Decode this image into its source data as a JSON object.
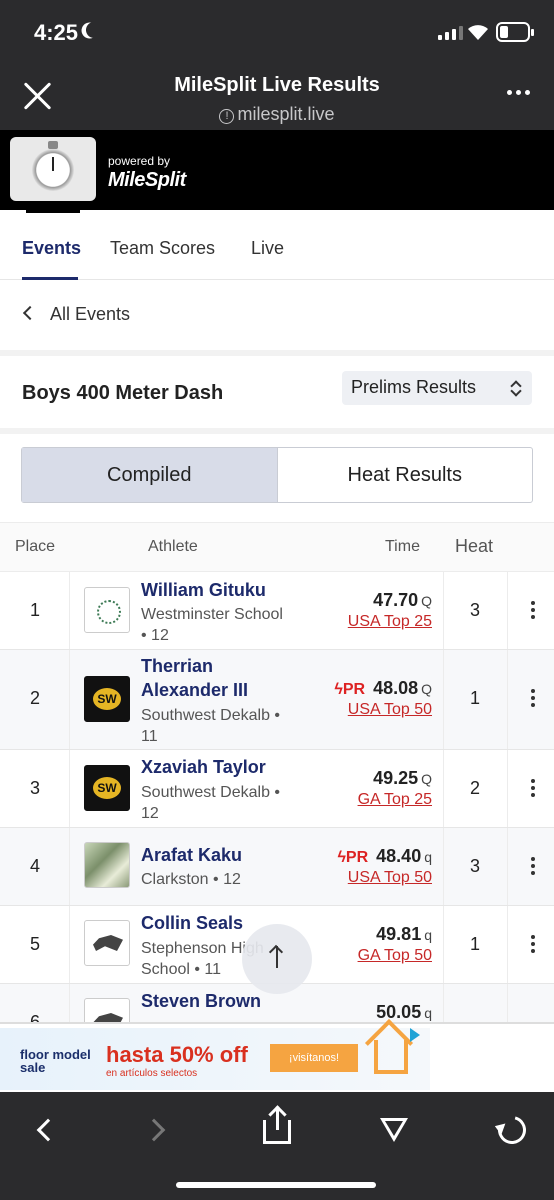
{
  "status_bar": {
    "time": "4:25"
  },
  "browser": {
    "title": "MileSplit Live Results",
    "url": "milesplit.live"
  },
  "brand": {
    "powered_by": "powered by",
    "name": "MileSplit"
  },
  "tabs": [
    {
      "label": "Events",
      "active": true
    },
    {
      "label": "Team Scores",
      "active": false
    },
    {
      "label": "Live",
      "active": false
    }
  ],
  "back_link": "All Events",
  "event": {
    "title": "Boys 400 Meter Dash",
    "round": "Prelims Results"
  },
  "view_toggle": {
    "compiled": "Compiled",
    "heat_results": "Heat Results",
    "selected": "Compiled"
  },
  "table": {
    "headers": {
      "place": "Place",
      "athlete": "Athlete",
      "time": "Time",
      "heat": "Heat"
    },
    "rows": [
      {
        "place": "1",
        "name_lines": [
          "William Gituku"
        ],
        "school_lines": [
          "Westminster School",
          "• 12"
        ],
        "pr": "",
        "time": "47.70",
        "qual": "Q",
        "rank": "USA Top 25",
        "heat": "3",
        "logo": "westminster-logo"
      },
      {
        "place": "2",
        "name_lines": [
          "Therrian",
          "Alexander III"
        ],
        "school_lines": [
          "Southwest Dekalb •",
          "11"
        ],
        "pr": "PR",
        "time": "48.08",
        "qual": "Q",
        "rank": "USA Top 50",
        "heat": "1",
        "logo": "southwest-dekalb-logo"
      },
      {
        "place": "3",
        "name_lines": [
          "Xzaviah Taylor"
        ],
        "school_lines": [
          "Southwest Dekalb •",
          "12"
        ],
        "pr": "",
        "time": "49.25",
        "qual": "Q",
        "rank": "GA Top 25",
        "heat": "2",
        "logo": "southwest-dekalb-logo"
      },
      {
        "place": "4",
        "name_lines": [
          "Arafat Kaku"
        ],
        "school_lines": [
          "Clarkston • 12"
        ],
        "pr": "PR",
        "time": "48.40",
        "qual": "q",
        "rank": "USA Top 50",
        "heat": "3",
        "logo": "clarkston-logo"
      },
      {
        "place": "5",
        "name_lines": [
          "Collin Seals"
        ],
        "school_lines": [
          "Stephenson High",
          "School • 11"
        ],
        "pr": "",
        "time": "49.81",
        "qual": "q",
        "rank": "GA Top 50",
        "heat": "1",
        "logo": "stephenson-logo"
      },
      {
        "place": "6",
        "name_lines": [
          "Steven Brown"
        ],
        "school_lines": [],
        "pr": "",
        "time": "50.05",
        "qual": "q",
        "rank": "",
        "heat": "",
        "logo": "stephenson-logo"
      }
    ]
  },
  "ad": {
    "brand": "floor model sale",
    "headline": "hasta 50% off",
    "subtext": "en artículos selectos",
    "cta": "¡visítanos!"
  },
  "colors": {
    "accent_navy": "#1d2a6b",
    "rank_red": "#c62828",
    "chrome_dark": "#2b2b2d"
  }
}
